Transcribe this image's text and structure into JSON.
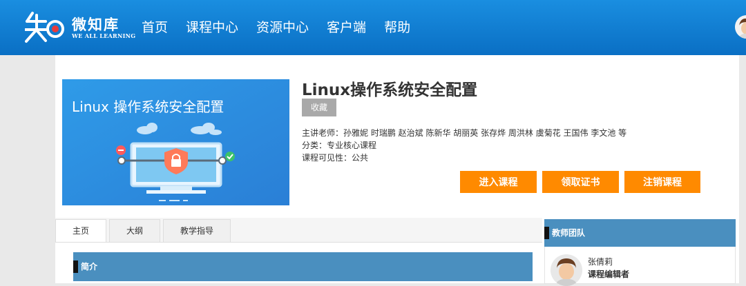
{
  "brand": {
    "name": "微知库",
    "slogan": "WE ALL LEARNING"
  },
  "nav": {
    "items": [
      "首页",
      "课程中心",
      "资源中心",
      "客户端",
      "帮助"
    ]
  },
  "course": {
    "cover_text": "Linux 操作系统安全配置",
    "title": "Linux操作系统安全配置",
    "favorite_label": "收藏",
    "teachers": "主讲老师：孙雅妮 时瑞鹏 赵治斌 陈新华 胡丽英 张存烨 周洪林 虞菊花 王国伟 李文池 等",
    "category": "分类：专业核心课程",
    "visibility": "课程可见性：公共",
    "enter_label": "进入课程",
    "certificate_label": "领取证书",
    "cancel_label": "注销课程"
  },
  "tabs": [
    "主页",
    "大纲",
    "教学指导"
  ],
  "intro_section": {
    "title": "简介"
  },
  "team": {
    "title": "教师团队",
    "member_name": "张倩莉",
    "member_role": "课程编辑者"
  },
  "colors": {
    "header": "#0a6fc4",
    "accent": "#ff8a00",
    "section": "#4a8fbf"
  }
}
